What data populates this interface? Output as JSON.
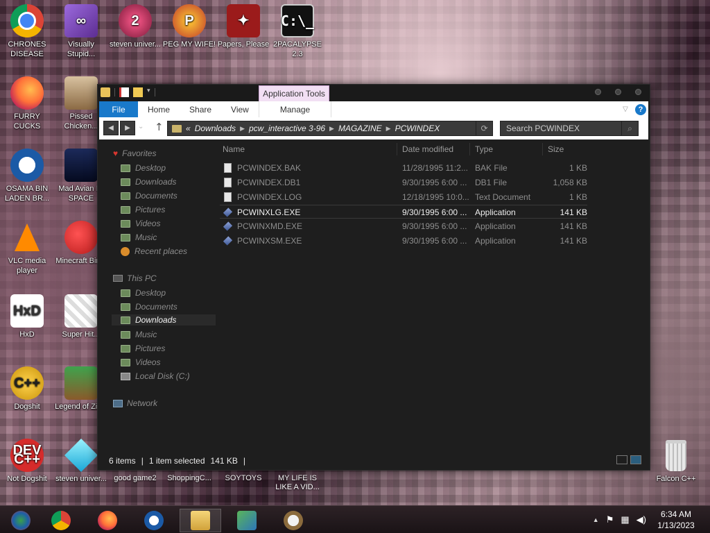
{
  "desktop": {
    "icons": [
      {
        "label": "CHRONES DISEASE",
        "icon": "chrome-icon"
      },
      {
        "label": "Visually Stupid...",
        "icon": "visual-studio-icon"
      },
      {
        "label": "steven univer...",
        "icon": "steven-universe-icon"
      },
      {
        "label": "PEG MY WIFE!",
        "icon": "peggle-icon"
      },
      {
        "label": "Papers, Please",
        "icon": "papers-please-icon"
      },
      {
        "label": "2PACALYPSE 2.3",
        "icon": "cmd-icon"
      },
      {
        "label": "FURRY CUCKS",
        "icon": "firefox-icon"
      },
      {
        "label": "Pissed Chicken...",
        "icon": "angry-birds-seasons-icon"
      },
      {
        "label": "OSAMA BIN LADEN BR...",
        "icon": "obama-logo-icon"
      },
      {
        "label": "Mad Avian IN SPACE",
        "icon": "angry-birds-space-icon"
      },
      {
        "label": "VLC media player",
        "icon": "vlc-icon"
      },
      {
        "label": "Minecraft Birds",
        "icon": "angry-birds-icon"
      },
      {
        "label": "HxD",
        "icon": "hxd-icon"
      },
      {
        "label": "Super Hit...",
        "icon": "pixel-cat-icon"
      },
      {
        "label": "Dogshit",
        "icon": "cpp-icon"
      },
      {
        "label": "Legend of Zilda",
        "icon": "zelda-icon"
      },
      {
        "label": "Not Dogshit",
        "icon": "dev-cpp-icon"
      },
      {
        "label": "steven univer...",
        "icon": "diamond-icon"
      },
      {
        "label": "Falcon C++",
        "icon": "recycle-bin-icon"
      }
    ],
    "partial_labels": [
      "good game2",
      "ShoppingC...",
      "SOYTOYS",
      "MY LIFE IS LIKE A VID..."
    ]
  },
  "window": {
    "context_tab": "Application Tools",
    "ribbon": {
      "file": "File",
      "tabs": [
        "Home",
        "Share",
        "View"
      ],
      "manage": "Manage"
    },
    "address": {
      "overflow": "«",
      "crumbs": [
        "Downloads",
        "pcw_interactive 3-96",
        "MAGAZINE",
        "PCWINDEX"
      ]
    },
    "search_placeholder": "Search PCWINDEX",
    "nav": {
      "favorites": "Favorites",
      "favorites_items": [
        "Desktop",
        "Downloads",
        "Documents",
        "Pictures",
        "Videos",
        "Music",
        "Recent places"
      ],
      "this_pc": "This PC",
      "this_pc_items": [
        "Desktop",
        "Documents",
        "Downloads",
        "Music",
        "Pictures",
        "Videos",
        "Local Disk (C:)"
      ],
      "network": "Network"
    },
    "columns": [
      "Name",
      "Date modified",
      "Type",
      "Size"
    ],
    "files": [
      {
        "name": "PCWINDEX.BAK",
        "date": "11/28/1995 11:2...",
        "type": "BAK File",
        "size": "1 KB",
        "icon": "document-icon"
      },
      {
        "name": "PCWINDEX.DB1",
        "date": "9/30/1995 6:00 ...",
        "type": "DB1 File",
        "size": "1,058 KB",
        "icon": "document-icon"
      },
      {
        "name": "PCWINDEX.LOG",
        "date": "12/18/1995 10:0...",
        "type": "Text Document",
        "size": "1 KB",
        "icon": "document-icon"
      },
      {
        "name": "PCWINXLG.EXE",
        "date": "9/30/1995 6:00 ...",
        "type": "Application",
        "size": "141 KB",
        "icon": "application-icon"
      },
      {
        "name": "PCWINXMD.EXE",
        "date": "9/30/1995 6:00 ...",
        "type": "Application",
        "size": "141 KB",
        "icon": "application-icon"
      },
      {
        "name": "PCWINXSM.EXE",
        "date": "9/30/1995 6:00 ...",
        "type": "Application",
        "size": "141 KB",
        "icon": "application-icon"
      }
    ],
    "status": {
      "count": "6 items",
      "selected": "1 item selected",
      "size": "141 KB"
    }
  },
  "taskbar": {
    "time": "6:34 AM",
    "date": "1/13/2023"
  },
  "colors": {
    "accent_blue": "#1979ca",
    "context_tab_bg": "#f2dff4",
    "window_bg": "#1e1e1e"
  }
}
